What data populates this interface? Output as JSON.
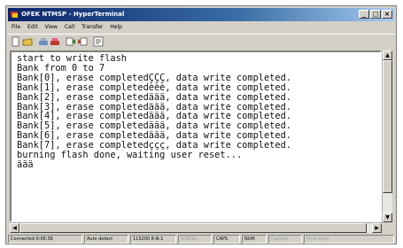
{
  "window": {
    "title": "OFEK NTMSP - HyperTerminal"
  },
  "window_buttons": {
    "minimize": "_",
    "maximize": "□",
    "close": "×"
  },
  "menu": [
    "File",
    "Edit",
    "View",
    "Call",
    "Transfer",
    "Help"
  ],
  "toolbar": {
    "icons": [
      "new-connection-icon",
      "open-icon",
      "call-icon",
      "disconnect-icon",
      "send-icon",
      "receive-icon",
      "properties-icon"
    ]
  },
  "terminal": {
    "lines": [
      "start to write flash",
      "Bank from 0 to 7",
      "Bank[0], erase completedÇÇÇ, data write completed.",
      "Bank[1], erase completedèèè, data write completed.",
      "Bank[2], erase completedäää, data write completed.",
      "Bank[3], erase completedäää, data write completed.",
      "Bank[4], erase completedäää, data write completed.",
      "Bank[5], erase completedäää, data write completed.",
      "Bank[6], erase completedäää, data write completed.",
      "Bank[7], erase completedççç, data write completed.",
      "burning flash done, waiting user reset...",
      "äää"
    ]
  },
  "status": {
    "connection": "Connected 0:06:36",
    "detect": "Auto detect",
    "settings": "115200 8-N-1",
    "scroll": "SCROLL",
    "caps": "CAPS",
    "num": "NUM",
    "capture": "Capture",
    "print_echo": "Print echo"
  },
  "colors": {
    "title_active": "#0a246a",
    "chrome": "#d4d0c8"
  }
}
